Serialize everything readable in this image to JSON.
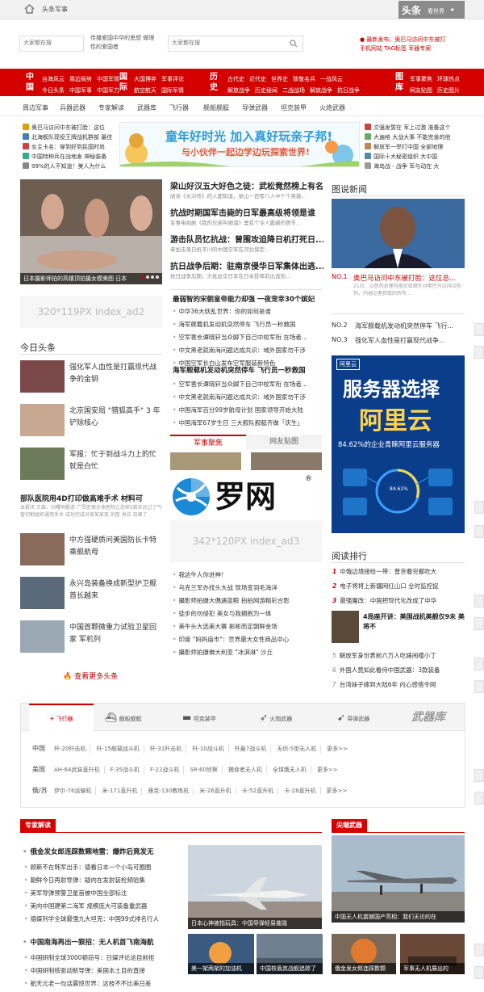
{
  "topbar": {
    "crumb": "头条军事",
    "brand_main": "头条",
    "brand_sub": "看世界"
  },
  "header": {
    "search1_placeholder": "大家都在搜",
    "slogan": "传播爱国中华的思想 做理性的爱国者",
    "search2_placeholder": "大家都在搜",
    "hot1": "● 最新发布：奥巴马访问中东被打",
    "hot2": "手机网站  TAG标签  军器专案"
  },
  "rednav": {
    "groups": [
      {
        "name": "中国",
        "row1": [
          "台海风云",
          "周边局势",
          "中国军情"
        ],
        "row2": [
          "今日头条",
          "中国军事",
          "中国军力"
        ]
      },
      {
        "name": "国际",
        "row1": [
          "大国博弈",
          "军事评论"
        ],
        "row2": [
          "航空航天",
          "国际军情"
        ]
      },
      {
        "name": "历史",
        "row1": [
          "古代史",
          "近代史",
          "世界史",
          "致敬名兵",
          "一战风云"
        ],
        "row2": [
          "解放战争",
          "历史秘闻",
          "二战战场",
          "解放战争",
          "抗日战争"
        ]
      },
      {
        "name": "图库",
        "row1": [
          "军事聚焦",
          "环球热点"
        ],
        "row2": [
          "网友贴图",
          "历史图片"
        ]
      }
    ]
  },
  "subnav": [
    "周边军事",
    "兵器武器",
    "专家解读",
    "武器库",
    "飞行器",
    "舰船舰艇",
    "导弹武器",
    "坦克装甲",
    "火炮武器"
  ],
  "topnews": {
    "left": [
      "奥巴马访问中东被打脸：这位",
      "北海舰队现役王牌战机群部 最佳",
      "女主卡名：穿到好到民国时尚",
      "中国特种兵在战地发 神秘装备",
      "99%的人不知道！美人为什么"
    ],
    "right": [
      "文强发誓在 军上过激 准备这个",
      "大遍格 大战大事 不能完善的他",
      "解放军一举打中国 全部地理",
      "国际十大秘密组织 大中国",
      "海岛战 - 战争 军与动在 大"
    ]
  },
  "banner": {
    "line1": "童年好时光 加入真好玩亲子邦!",
    "line2": "与小伙伴一起边学边玩探索世界!"
  },
  "slider": {
    "caption": "日本摄影师拍的高楼顶拍摄女模美图 日本"
  },
  "center_top": [
    {
      "title": "梁山好汉五大好色之徒：武松竟然榜上有名",
      "snip": "阅读《水浒传》的人都知道，梁山一百零八人中个个英雄..."
    },
    {
      "title": "抗战时期国军击毙的日军最高级将领是谁",
      "snip": "军事电视剧《我的兄弟叫顺溜》里有个令人震撼的情节..."
    },
    {
      "title": "游击队员忆抗战：曾围攻迫降日机打死日...",
      "snip": "参加击落日机平川的中国空军在河北保定..."
    },
    {
      "title": "抗日战争后期：驻南京侵华日军集体出逃...",
      "snip": "抗日战争后期，大批驻华日军在日本投降前出逃到..."
    }
  ],
  "ad2": "320*119PX index_ad2",
  "mid_list1": {
    "title": "最弱智的宋朝皇帝能力却强 一夜宠幸30个嫔妃",
    "items": [
      "中华36大妖乱世界：你的如何是谁",
      "海军舰载机发动机突然停车 飞行员一秒救国",
      "空军害长谭晓轩当众脚下自己中校军衔 在场者...",
      "中文黑老就南海问题达成共识：域外国家勿干涉",
      "中国空军长白山发布空军服装新特色"
    ]
  },
  "mid_list2": {
    "title": "海军舰载机发动机突然停车 飞行员一秒救国",
    "items": [
      "空军害长谭晓轩当众脚下自己中校军衔 在场者...",
      "中文黑老就南海问题达成共识：域外国家勿干涉",
      "中国海军百分99岁航母计划 国家领导开始大陆",
      "中国海军67岁生日 三大舰队舰艇齐做「庆生」"
    ]
  },
  "tabs": [
    "军事聚焦",
    "网友贴图"
  ],
  "logo": {
    "text": "罗网",
    "reg": "®"
  },
  "ad3": "342*120PX index_ad3",
  "mid_list3": [
    "我这牛人你进神！",
    "乌克兰军办找头大战 现场变羽毛海洋",
    "攝影师拍摄大偶遇蓝鲸 拍拍网游精彩合影",
    "徒步的勿侵犯 美女与我拥抱为一体",
    "美牛头大选美大赛 彬彬而定朝鲜金场",
    "印度 \"妈妈庙市\"：世界最大女性商品中心",
    "攝影师拍摄佛大利亚 \"冰淇淋\" 沙丘"
  ],
  "today": {
    "title": "今日头条",
    "items": [
      {
        "text": "强化军人血性是打赢现代战争的金钥"
      },
      {
        "text": "北京国安局 \"猎狐高手\" 3 年铲除核心"
      },
      {
        "text": "军报：忙于到战斗力上的忙就是白忙"
      }
    ],
    "feature_title": "部队医院用4D打印做高难手术 材料可",
    "feature_snip": "本报讯 王森、刘曙明报道 广军医保全体医院让连续5周未达过了气管切割组织通用手术 成功完成对某某某某 的医 发应 效果了",
    "items2": [
      {
        "text": "中方强硬质问美国防长卡特乘舰航母"
      },
      {
        "text": "永兴岛装备换成新型护卫舰 首长越来"
      },
      {
        "text": "中国首颗微重力试验卫星回家 军机列"
      }
    ],
    "more": "查看更多头条"
  },
  "rightcol": {
    "title": "图说新闻",
    "no1_label": "NO.1",
    "no1_title": "奥巴马访问中东被打脸：这位总...",
    "no1_snip": "21日，以色列总理内塔尼亚胡针对奥巴马访问以色列，内容记者获取的所有...",
    "no2_label": "NO.2",
    "no2_title": "海军舰载机发动机突然停车 飞行...",
    "no3_label": "NO.3",
    "no3_title": "强化军人血性是打赢现代战争...",
    "ad_brand": "阿里云",
    "ad_line1": "服务器选择",
    "ad_line2": "阿里云",
    "ad_line3": "84.62%的企业青睐阿里云服务器",
    "ad_pct": "84.62%",
    "ranking_title": "阅读排行",
    "ranking": [
      {
        "n": "1",
        "t": "中俄边境接给一带：普京看完都吃大"
      },
      {
        "n": "2",
        "t": "电子将将上新疆网红山口 全时监控捉"
      },
      {
        "n": "3",
        "t": "最强魔改：中国把现代化改成了中华"
      },
      {
        "n": "4",
        "t": "局座开讲：美国战机美舰仅9未 美将不"
      },
      {
        "n": "5",
        "t": "解放军身份表前六万人吃婊闹禮小丁"
      },
      {
        "n": "6",
        "t": "外国人竟如此看待中国武器：3款装备"
      },
      {
        "n": "7",
        "t": "台湾妹子嫁到大陆6年 内心感悟令网"
      }
    ]
  },
  "weapons": {
    "tabs": [
      "飞行器",
      "舰船舰艇",
      "坦克装甲",
      "火炮武器",
      "导弹武器"
    ],
    "tag": "武器库",
    "rows": [
      {
        "label": "中国",
        "items": [
          "歼-20歼击机",
          "歼-15舰载战斗机",
          "歼-31歼击机",
          "歼-10战斗机",
          "歼轰7战斗机",
          "无侦-5型无人机",
          "更多>>"
        ]
      },
      {
        "label": "美国",
        "items": [
          "AH-64武装直升机",
          "F-35战斗机",
          "F-22战斗机",
          "SR-60侦察",
          "捕食者无人机",
          "全球鹰无人机",
          "更多>>"
        ]
      },
      {
        "label": "俄/苏",
        "items": [
          "伊尔-76运输机",
          "米-171直升机",
          "雅克-130教练机",
          "米-26直升机",
          "卡-52直升机",
          "卡-28直升机",
          "更多>>"
        ]
      }
    ]
  },
  "expert": {
    "title": "专家解读",
    "head1": "俄金发女郎连踩数颗地雷：爆炸后竟发无",
    "list1": [
      "顾斯不在韩军出手：德看日本一个小岛可圈圈",
      "朝鲜今日再射导弹：疑向在发射装检频验集",
      "美军导弹预警卫星首被中国全部标注",
      "美向中国建第二海军 规模庞大可装备重武器",
      "德媒列学全球最强九大坦克：中国99式排名行人"
    ],
    "photo_caption": "日本心神被指玩具：中国导弹轻易摧毁",
    "head2": "中国南海再出一狠招：无人机首飞南海航",
    "list2": [
      "中国研制全球3000顿窃号：日媒评论这目前拒",
      "中国研制核驱动新导弹：美国本土目的直接",
      "航天元老一句话震惊世界：这枝不不比美日差"
    ],
    "thumb1": "美一架两架的加油机",
    "thumb2": "中国核盾其战舰追踪了"
  },
  "sharp": {
    "title": "尖端武器",
    "caption1": "中国无人机震撼国产亮相：我们无论的在",
    "thumb1": "俄金发女郎连踩数颗",
    "thumb2": "军事无人机展出的"
  },
  "colors": {
    "red": "#d40000",
    "navy": "#1e3a6e",
    "aliyun": "#0b3e8a"
  }
}
